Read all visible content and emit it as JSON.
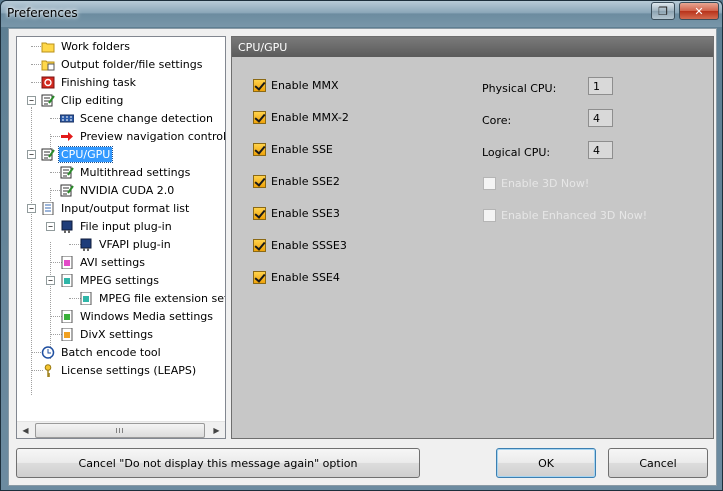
{
  "window": {
    "title": "Preferences"
  },
  "tree": {
    "items": [
      {
        "label": "Work folders",
        "icon": "folder-icon"
      },
      {
        "label": "Output folder/file settings",
        "icon": "output-folder-icon"
      },
      {
        "label": "Finishing task",
        "icon": "finishing-task-icon"
      },
      {
        "label": "Clip editing",
        "icon": "clip-editing-icon"
      },
      {
        "label": "Scene change detection",
        "icon": "scene-detection-icon"
      },
      {
        "label": "Preview navigation control",
        "icon": "red-arrow-icon"
      },
      {
        "label": "CPU/GPU",
        "icon": "cpu-gpu-icon"
      },
      {
        "label": "Multithread settings",
        "icon": "multithread-icon"
      },
      {
        "label": "NVIDIA CUDA 2.0",
        "icon": "cuda-icon"
      },
      {
        "label": "Input/output format list",
        "icon": "format-list-icon"
      },
      {
        "label": "File input plug-in",
        "icon": "plugin-icon"
      },
      {
        "label": "VFAPI plug-in",
        "icon": "vfapi-plugin-icon"
      },
      {
        "label": "AVI settings",
        "icon": "avi-file-icon"
      },
      {
        "label": "MPEG settings",
        "icon": "mpeg-icon"
      },
      {
        "label": "MPEG file extension setting",
        "icon": "mpeg-extension-icon"
      },
      {
        "label": "Windows Media settings",
        "icon": "windows-media-icon"
      },
      {
        "label": "DivX settings",
        "icon": "divx-icon"
      },
      {
        "label": "Batch encode tool",
        "icon": "clock-icon"
      },
      {
        "label": "License settings (LEAPS)",
        "icon": "key-icon"
      }
    ],
    "scroll_grip": "III"
  },
  "panel": {
    "header": "CPU/GPU",
    "checkboxes": [
      {
        "label": "Enable MMX",
        "checked": true
      },
      {
        "label": "Enable MMX-2",
        "checked": true
      },
      {
        "label": "Enable SSE",
        "checked": true
      },
      {
        "label": "Enable SSE2",
        "checked": true
      },
      {
        "label": "Enable SSE3",
        "checked": true
      },
      {
        "label": "Enable SSSE3",
        "checked": true
      },
      {
        "label": "Enable SSE4",
        "checked": true
      }
    ],
    "cpu_info": [
      {
        "label": "Physical CPU:",
        "value": "1"
      },
      {
        "label": "Core:",
        "value": "4"
      },
      {
        "label": "Logical CPU:",
        "value": "4"
      }
    ],
    "disabled_checkboxes": [
      {
        "label": "Enable 3D Now!",
        "checked": false
      },
      {
        "label": "Enable Enhanced 3D Now!",
        "checked": false
      }
    ]
  },
  "buttons": {
    "cancel_message": "Cancel \"Do not display this message again\" option",
    "ok": "OK",
    "cancel": "Cancel"
  },
  "colors": {
    "selection": "#3399ff",
    "panel_bg": "#c7c7c7",
    "panel_header": "#5b5b5b",
    "checkbox_fill": "#f0a30a"
  }
}
